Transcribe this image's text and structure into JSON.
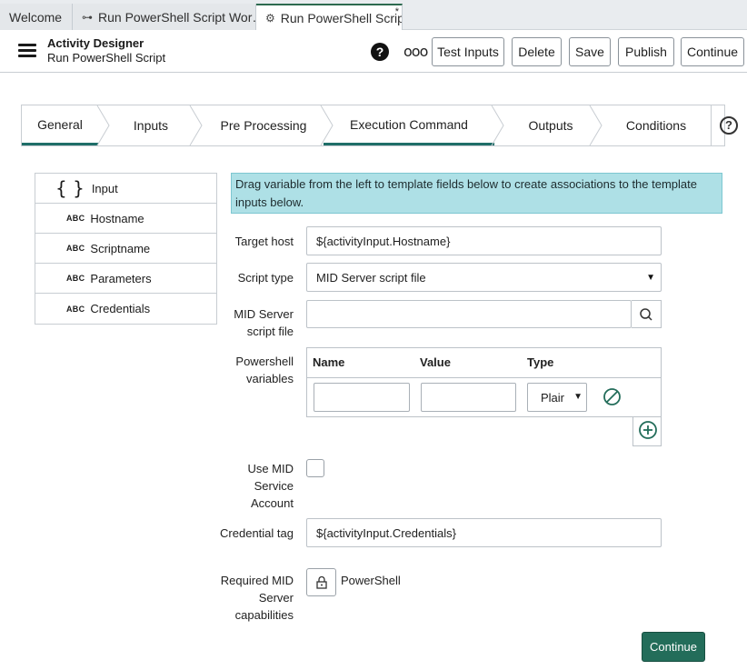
{
  "tabs": [
    {
      "label": "Welcome",
      "icon": ""
    },
    {
      "label": "Run PowerShell Script Wor…",
      "icon": "workflow-icon"
    },
    {
      "label": "Run PowerShell Script",
      "icon": "activity-icon",
      "dirty_marker": "*"
    }
  ],
  "header": {
    "app_title": "Activity Designer",
    "subtitle": "Run PowerShell Script",
    "help_glyph": "?",
    "buttons": {
      "test_inputs": "Test Inputs",
      "delete": "Delete",
      "save": "Save",
      "publish": "Publish",
      "continue": "Continue"
    }
  },
  "steps": [
    {
      "label": "General",
      "selected": true
    },
    {
      "label": "Inputs",
      "selected": false
    },
    {
      "label": "Pre Processing",
      "selected": false
    },
    {
      "label": "Execution Command",
      "selected": true
    },
    {
      "label": "Outputs",
      "selected": false
    },
    {
      "label": "Conditions",
      "selected": false
    }
  ],
  "steps_help_glyph": "?",
  "variables": {
    "root_label": "Input",
    "type_tag": "ABC",
    "items": [
      "Hostname",
      "Scriptname",
      "Parameters",
      "Credentials"
    ]
  },
  "info_message": "Drag variable from the left to template fields below to create associations to the template inputs below.",
  "form": {
    "target_host": {
      "label": "Target host",
      "value": "${activityInput.Hostname}"
    },
    "script_type": {
      "label": "Script type",
      "value": "MID Server script file"
    },
    "mid_script_file": {
      "label": "MID Server script file",
      "value": ""
    },
    "powershell_variables": {
      "label": "Powershell variables",
      "columns": [
        "Name",
        "Value",
        "Type"
      ],
      "row": {
        "name": "",
        "value": "",
        "type": "Plair"
      }
    },
    "use_mid_service_account": {
      "label": "Use MID Service Account",
      "checked": false
    },
    "credential_tag": {
      "label": "Credential tag",
      "value": "${activityInput.Credentials}"
    },
    "required_capabilities": {
      "label": "Required MID Server capabilities",
      "value": "PowerShell"
    }
  },
  "footer": {
    "continue_label": "Continue"
  },
  "colors": {
    "accent": "#236d5a",
    "info_bg": "#aee0e6",
    "step_underline": "#1f6e68"
  }
}
